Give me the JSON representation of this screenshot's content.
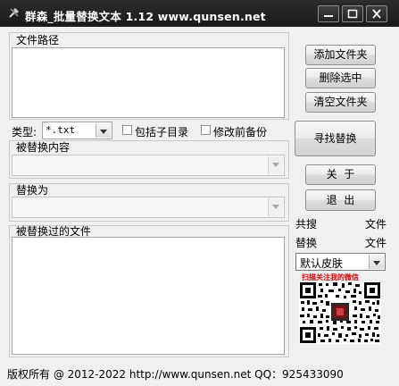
{
  "window": {
    "title": "群森_批量替换文本  1.12   www.qunsen.net",
    "icon": "tools-icon"
  },
  "file_path": {
    "label": "文件路径",
    "value": ""
  },
  "type_filter": {
    "label": "类型:",
    "value": "*.txt"
  },
  "include_subdirs": {
    "label": "包括子目录",
    "checked": false
  },
  "backup_before": {
    "label": "修改前备份",
    "checked": false
  },
  "find_section": {
    "label": "被替换内容",
    "value": ""
  },
  "replace_section": {
    "label": "替换为",
    "value": ""
  },
  "replaced_files": {
    "label": "被替换过的文件",
    "value": ""
  },
  "buttons": {
    "add_folder": "添加文件夹",
    "delete_selected": "删除选中",
    "clear_folders": "清空文件夹",
    "find_replace": "寻找替换",
    "about": "关  于",
    "exit": "退  出"
  },
  "stats": {
    "total_label": "共搜",
    "total_unit": "文件",
    "replaced_label": "替换",
    "replaced_unit": "文件"
  },
  "skin": {
    "selected": "默认皮肤"
  },
  "qr": {
    "caption": "扫描关注我的微信"
  },
  "footer": {
    "text": "版权所有 @ 2012-2022   http://www.qunsen.net   QQ：925433090"
  },
  "colors": {
    "titlebar": "#1f1f1f",
    "background": "#f0f0f0",
    "qr_caption": "#e00000"
  }
}
